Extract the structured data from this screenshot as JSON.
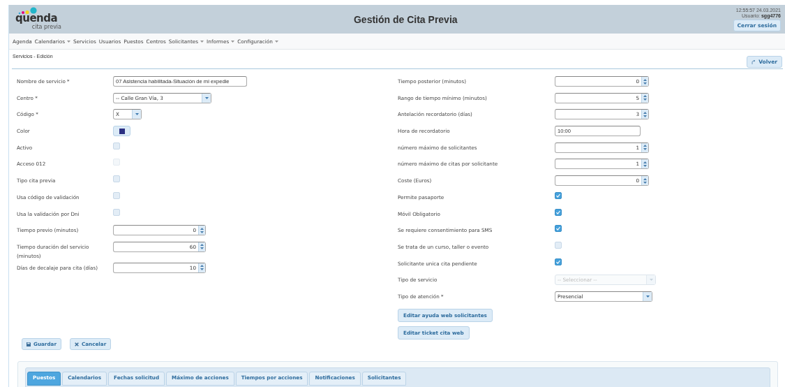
{
  "header": {
    "logo": {
      "name": "quenda",
      "tagline": "cita previa"
    },
    "title": "Gestión de Cita Previa",
    "timestamp": "12:55:57 24.03.2021",
    "user_label": "Usuario:",
    "user": "sgg4776",
    "logout": "Cerrar sesión"
  },
  "nav": [
    {
      "label": "Agenda",
      "menu": false
    },
    {
      "label": "Calendarios",
      "menu": true
    },
    {
      "label": "Servicios",
      "menu": false
    },
    {
      "label": "Usuarios",
      "menu": false
    },
    {
      "label": "Puestos",
      "menu": false
    },
    {
      "label": "Centros",
      "menu": false
    },
    {
      "label": "Solicitantes",
      "menu": true
    },
    {
      "label": "Informes",
      "menu": true
    },
    {
      "label": "Configuración",
      "menu": true
    }
  ],
  "breadcrumb": "Servicios - Edición",
  "back_button": "Volver",
  "left_fields": [
    {
      "kind": "text",
      "label": "Nombre de servicio *",
      "value": "07 Asistencia habilitada-Situación de mi expedie"
    },
    {
      "kind": "select",
      "label": "Centro *",
      "value": "-- Calle Gran Vía, 3",
      "disabled": false
    },
    {
      "kind": "select",
      "label": "Código *",
      "value": "X",
      "disabled": false
    },
    {
      "kind": "color",
      "label": "Color",
      "color": "#2b2f82"
    },
    {
      "kind": "checkbox",
      "label": "Activo",
      "checked": false,
      "disabled": false
    },
    {
      "kind": "checkbox",
      "label": "Acceso 012",
      "checked": false,
      "disabled": true
    },
    {
      "kind": "checkbox",
      "label": "Tipo cita previa",
      "checked": false,
      "disabled": false
    },
    {
      "kind": "checkbox",
      "label": "Usa código de validación",
      "checked": false,
      "disabled": false
    },
    {
      "kind": "checkbox",
      "label": "Usa la validación por Dni",
      "checked": false,
      "disabled": false
    },
    {
      "kind": "number",
      "label": "Tiempo previo (minutos)",
      "value": "0"
    },
    {
      "kind": "number",
      "label": "Tiempo duración del servicio (minutos)",
      "value": "60"
    },
    {
      "kind": "number",
      "label": "Días de decalaje para cita (días)",
      "value": "10"
    }
  ],
  "right_fields": [
    {
      "kind": "number",
      "label": "Tiempo posterior (minutos)",
      "value": "0"
    },
    {
      "kind": "number",
      "label": "Rango de tiempo mínimo (minutos)",
      "value": "5"
    },
    {
      "kind": "number",
      "label": "Antelación recordatorio (días)",
      "value": "3"
    },
    {
      "kind": "text",
      "label": "Hora de recordatorio",
      "value": "10:00"
    },
    {
      "kind": "number",
      "label": "número máximo de solicitantes",
      "value": "1"
    },
    {
      "kind": "number",
      "label": "número máximo de citas por solicitante",
      "value": "1"
    },
    {
      "kind": "number",
      "label": "Coste (Euros)",
      "value": "0"
    },
    {
      "kind": "checkbox",
      "label": "Permite pasaporte",
      "checked": true,
      "disabled": false
    },
    {
      "kind": "checkbox",
      "label": "Móvil Obligatorio",
      "checked": true,
      "disabled": false
    },
    {
      "kind": "checkbox",
      "label": "Se requiere consentimiento para SMS",
      "checked": true,
      "disabled": false
    },
    {
      "kind": "checkbox",
      "label": "Se trata de un curso, taller o evento",
      "checked": false,
      "disabled": false
    },
    {
      "kind": "checkbox",
      "label": "Solicitante unica cita pendiente",
      "checked": true,
      "disabled": false
    },
    {
      "kind": "select",
      "label": "Tipo de servicio",
      "placeholder": "-- Seleccionar --",
      "disabled": true
    },
    {
      "kind": "select",
      "label": "Tipo de atención *",
      "value": "Presencial",
      "disabled": false
    }
  ],
  "extra_buttons": [
    "Editar ayuda web solicitantes",
    "Editar ticket cita web"
  ],
  "actions": [
    {
      "kind": "save",
      "label": "Guardar"
    },
    {
      "kind": "cancel",
      "label": "Cancelar"
    }
  ],
  "tabs": [
    {
      "label": "Puestos",
      "selected": true
    },
    {
      "label": "Calendarios",
      "selected": false
    },
    {
      "label": "Fechas solicitud",
      "selected": false
    },
    {
      "label": "Máximo de acciones",
      "selected": false
    },
    {
      "label": "Tiempos por acciones",
      "selected": false
    },
    {
      "label": "Notificaciones",
      "selected": false
    },
    {
      "label": "Solicitantes",
      "selected": false
    }
  ]
}
